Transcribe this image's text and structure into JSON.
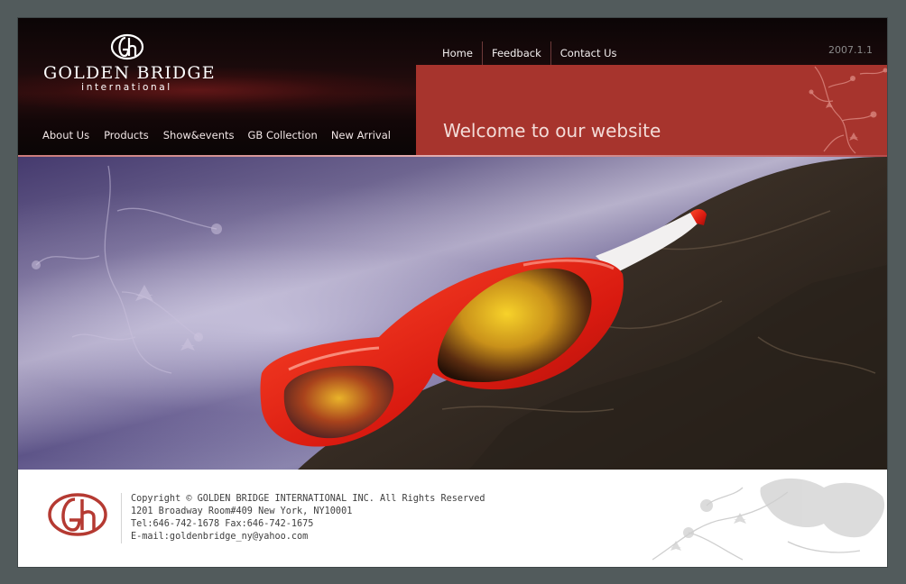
{
  "brand": {
    "name": "GOLDEN BRIDGE",
    "subtitle": "international"
  },
  "top_nav": [
    {
      "label": "Home"
    },
    {
      "label": "Feedback"
    },
    {
      "label": "Contact Us"
    }
  ],
  "version_date": "2007.1.1",
  "main_nav": [
    {
      "label": "About Us"
    },
    {
      "label": "Products"
    },
    {
      "label": "Show&events"
    },
    {
      "label": "GB Collection"
    },
    {
      "label": "New Arrival"
    }
  ],
  "welcome": {
    "text": "Welcome to our website"
  },
  "hero": {
    "icon": "red-sunglasses-on-rock-photo"
  },
  "footer": {
    "copyright": "Copyright © GOLDEN BRIDGE INTERNATIONAL INC. All Rights Reserved",
    "address": "1201 Broadway Room#409  New York, NY10001",
    "phone_fax": "Tel:646-742-1678  Fax:646-742-1675",
    "email": "E-mail:goldenbridge_ny@yahoo.com"
  },
  "colors": {
    "page_bg": "#525b5c",
    "brand_red": "#a7342d",
    "header_dark": "#1a0a0b",
    "footer_text": "#3e3e3e"
  }
}
